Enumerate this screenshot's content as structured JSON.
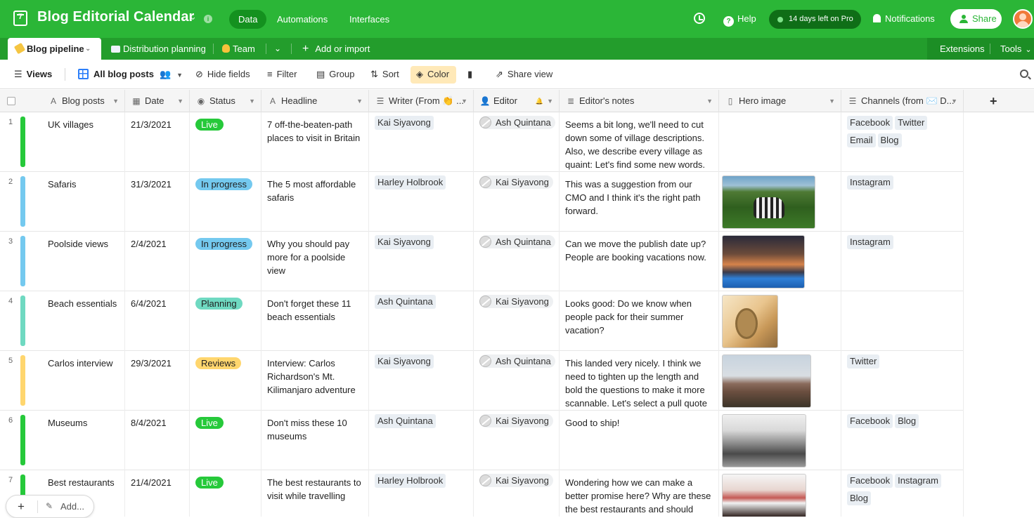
{
  "header": {
    "base_title": "Blog Editorial Calendar",
    "base_icon_label": "7",
    "nav": [
      "Data",
      "Automations",
      "Interfaces"
    ],
    "help": "Help",
    "trial": "14 days left on Pro",
    "notifications": "Notifications",
    "share": "Share"
  },
  "tables": {
    "active": "Blog pipeline",
    "tabs": [
      "Distribution planning",
      "Team"
    ],
    "add_import": "Add or import",
    "extensions": "Extensions",
    "tools": "Tools"
  },
  "viewbar": {
    "views": "Views",
    "view_name": "All blog posts",
    "hide_fields": "Hide fields",
    "filter": "Filter",
    "group": "Group",
    "sort": "Sort",
    "color": "Color",
    "share_view": "Share view"
  },
  "columns": [
    "Blog posts",
    "Date",
    "Status",
    "Headline",
    "Writer (From 👏 ...",
    "Editor",
    "Editor's notes",
    "Hero image",
    "Channels (from ✉️ D..."
  ],
  "colors": {
    "Live": "#26c93a",
    "In progress": "#74c9ef",
    "Planning": "#6fd9c1",
    "Reviews": "#ffd66e"
  },
  "rows": [
    {
      "num": "1",
      "post": "UK villages",
      "date": "21/3/2021",
      "status": "Live",
      "headline": "7 off-the-beaten-path places to visit in Britain",
      "writer": "Kai Siyavong",
      "editor": "Ash Quintana",
      "notes": "Seems a bit long, we'll need to cut down some of village descriptions. Also, we describe every village as quaint: Let's find some new words.",
      "hero": "",
      "channels": [
        "Facebook",
        "Twitter",
        "Email",
        "Blog"
      ]
    },
    {
      "num": "2",
      "post": "Safaris",
      "date": "31/3/2021",
      "status": "In progress",
      "headline": "The 5 most affordable safaris",
      "writer": "Harley Holbrook",
      "editor": "Kai Siyavong",
      "notes": "This was a suggestion from our CMO and I think it's the right path forward.",
      "hero": "safari",
      "channels": [
        "Instagram"
      ]
    },
    {
      "num": "3",
      "post": "Poolside views",
      "date": "2/4/2021",
      "status": "In progress",
      "headline": "Why you should pay more for a poolside view",
      "writer": "Kai Siyavong",
      "editor": "Ash Quintana",
      "notes": "Can we move the publish date up? People are booking vacations now.",
      "hero": "pool",
      "channels": [
        "Instagram"
      ]
    },
    {
      "num": "4",
      "post": "Beach essentials",
      "date": "6/4/2021",
      "status": "Planning",
      "headline": "Don't forget these 11 beach essentials",
      "writer": "Ash Quintana",
      "editor": "Kai Siyavong",
      "notes": "Looks good: Do we know when people pack for their summer vacation?",
      "hero": "beach",
      "channels": []
    },
    {
      "num": "5",
      "post": "Carlos interview",
      "date": "29/3/2021",
      "status": "Reviews",
      "headline": "Interview: Carlos Richardson's Mt. Kilimanjaro adventure",
      "writer": "Kai Siyavong",
      "editor": "Ash Quintana",
      "notes": "This landed very nicely. I think we need to tighten up the length and bold the questions to make it more scannable. Let's select a pull quote f...",
      "hero": "mountain",
      "channels": [
        "Twitter"
      ]
    },
    {
      "num": "6",
      "post": "Museums",
      "date": "8/4/2021",
      "status": "Live",
      "headline": "Don't miss these 10 museums",
      "writer": "Ash Quintana",
      "editor": "Kai Siyavong",
      "notes": "Good to ship!",
      "hero": "museum",
      "channels": [
        "Facebook",
        "Blog"
      ]
    },
    {
      "num": "7",
      "post": "Best restaurants",
      "date": "21/4/2021",
      "status": "Live",
      "headline": "The best restaurants to visit while travelling",
      "writer": "Harley Holbrook",
      "editor": "Kai Siyavong",
      "notes": "Wondering how we can make a better promise here? Why are these the best restaurants and should someone go",
      "hero": "rest",
      "channels": [
        "Facebook",
        "Instagram",
        "Blog"
      ]
    }
  ],
  "footer": {
    "add": "Add..."
  }
}
